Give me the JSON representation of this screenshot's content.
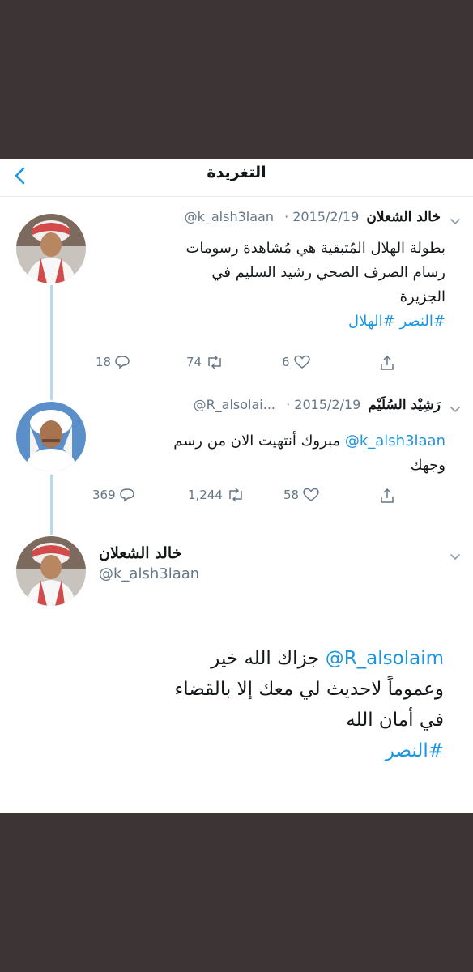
{
  "header": {
    "title": "التغريدة"
  },
  "tweet1": {
    "name": "خالد الشعلان",
    "handle": "@k_alsh3laan",
    "date": "· 2015/2/19",
    "lines": [
      "بطولة الهلال المُتبقية هي مُشاهدة رسومات",
      "رسام الصرف الصحي رشيد السليم في",
      "الجزيرة"
    ],
    "hashtags": "#النصر #الهلال",
    "replies": "18",
    "retweets": "74",
    "likes": "6"
  },
  "tweet2": {
    "name": "رَشِيْد السُلَيْم",
    "handle": "@R_alsolai...",
    "date": "· 2015/2/19",
    "mention": "@k_alsh3laan",
    "line1_rest": " مبروك أنتهيت الان من رسم",
    "line2": "وجهك",
    "replies": "369",
    "retweets": "1,244",
    "likes": "58"
  },
  "tweet3": {
    "name": "خالد الشعلان",
    "handle": "@k_alsh3laan",
    "mention": "@R_alsolaim",
    "line1_rest": " جزاك الله خير",
    "line2": "وعموماً لاحديث لي معك إلا بالقضاء",
    "line3": "في أمان الله",
    "hashtag": "#النصر"
  },
  "colors": {
    "link": "#1b95e0",
    "text": "#14171a",
    "muted": "#657786",
    "thread": "#b7d8f2",
    "backdrop": "#3d3535"
  },
  "icons": [
    "chevron-left-icon",
    "chevron-down-icon",
    "reply-icon",
    "retweet-icon",
    "like-icon",
    "share-icon"
  ]
}
